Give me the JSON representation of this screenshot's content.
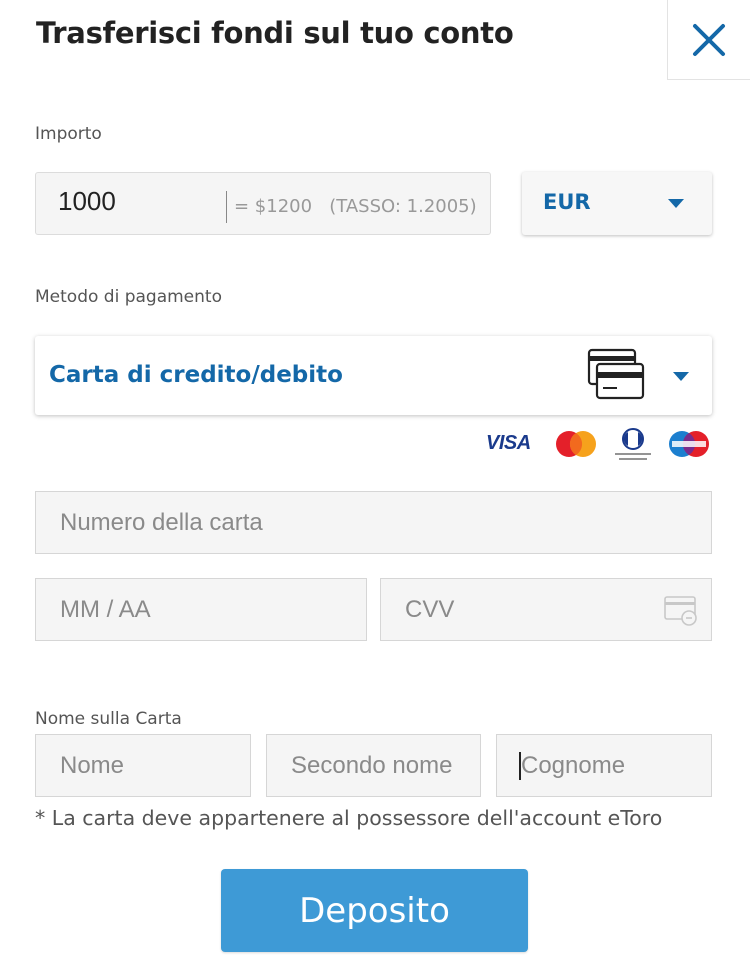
{
  "header": {
    "title": "Trasferisci fondi sul tuo conto",
    "close_icon": "close-icon"
  },
  "amount": {
    "label": "Importo",
    "value": "1000",
    "conversion": "= $1200   (TASSO: 1.2005)"
  },
  "currency": {
    "selected": "EUR"
  },
  "payment": {
    "label": "Metodo di pagamento",
    "selected": "Carta di credito/debito",
    "icon": "credit-cards-icon",
    "card_logos": [
      "VISA",
      "MasterCard",
      "Diners Club International",
      "Maestro"
    ]
  },
  "card": {
    "number_placeholder": "Numero della carta",
    "expiry_placeholder": "MM / AA",
    "cvv_placeholder": "CVV"
  },
  "name": {
    "label": "Nome sulla Carta",
    "first_placeholder": "Nome",
    "middle_placeholder": "Secondo nome",
    "last_placeholder": "Cognome"
  },
  "note": "* La carta deve appartenere al possessore dell'account eToro",
  "submit_label": "Deposito",
  "colors": {
    "accent": "#1468a8",
    "button": "#3e9ad6",
    "field_bg": "#f5f5f5"
  }
}
